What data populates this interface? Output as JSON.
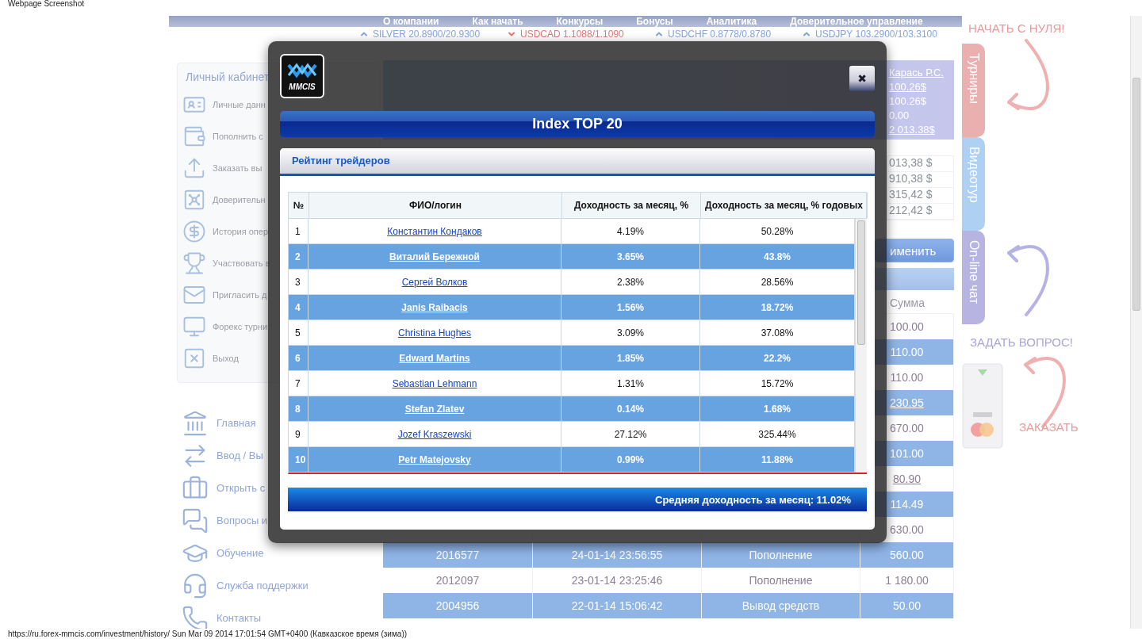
{
  "page_title": "Webpage Screenshot",
  "nav": [
    "О компании",
    "Как начать",
    "Конкурсы",
    "Бонусы",
    "Аналитика",
    "Доверительное управление"
  ],
  "ticker": [
    {
      "text": "SILVER 20.8900/20.9300",
      "up": true
    },
    {
      "text": "USDCAD 1.1088/1.1090",
      "up": false
    },
    {
      "text": "USDCHF 0.8778/0.8780",
      "up": true
    },
    {
      "text": "USDJPY 103.2900/103.3100",
      "up": true
    }
  ],
  "cabinet": {
    "title": "Личный кабинет",
    "items": [
      "Личные данн",
      "Пополнить с",
      "Заказать вы",
      "Доверительн",
      "История опер",
      "Участвовать в",
      "Пригласить д",
      "Форекс турни",
      "Выход"
    ]
  },
  "menu": [
    "Главная",
    "Ввод / Вы",
    "Открыть с",
    "Вопросы и",
    "Обучение",
    "Служба поддержки",
    "Контакты"
  ],
  "account": {
    "values": [
      {
        "value": "Карась Р.С.",
        "link": true
      },
      {
        "value": "100.26$",
        "link": true
      },
      {
        "value": "100.26$",
        "link": false
      },
      {
        "value": "0.00",
        "link": false
      },
      {
        "value": "2 013.38$",
        "link": true
      }
    ]
  },
  "stats": [
    "013,38 $",
    "910,38 $",
    "315,42 $",
    "212,42 $"
  ],
  "apply_button": "именить",
  "history": {
    "amount_header": "Сумма",
    "rows": [
      {
        "amount": "100.00",
        "link": false
      },
      {
        "amount": "110.00",
        "link": false
      },
      {
        "amount": "110.00",
        "link": false
      },
      {
        "amount": "230.95",
        "link": true
      },
      {
        "amount": "670.00",
        "link": false
      },
      {
        "amount": "101.00",
        "link": false
      },
      {
        "amount": "80.90",
        "link": true
      },
      {
        "amount": "114.49",
        "link": false
      },
      {
        "amount": "630.00",
        "link": false
      },
      {
        "id": "2016577",
        "date": "24-01-14 23:56:55",
        "type": "Пополнение",
        "amount": "560.00",
        "link": false
      },
      {
        "id": "2012097",
        "date": "23-01-14 23:25:46",
        "type": "Пополнение",
        "amount": "1 180.00",
        "link": false
      },
      {
        "id": "2004956",
        "date": "22-01-14 15:06:42",
        "type": "Вывод средств",
        "amount": "50.00",
        "link": false
      }
    ]
  },
  "rail": {
    "start": "НАЧАТЬ С НУЛЯ!",
    "tabs": [
      {
        "label": "Турниры",
        "color": "#eab0b0"
      },
      {
        "label": "Видеотур",
        "color": "#aed0f2"
      },
      {
        "label": "On-line чат",
        "color": "#b8b4e2"
      }
    ],
    "ask": "ЗАДАТЬ ВОПРОС!",
    "order": "ЗАКАЗАТЬ"
  },
  "modal": {
    "logo_text": "MMCIS",
    "close": "✖",
    "title": "Index TOP 20",
    "panel_title": "Рейтинг трейдеров",
    "columns": [
      "№",
      "ФИО/логин",
      "Доходность за месяц, %",
      "Доходность за месяц, % годовых"
    ],
    "rows": [
      {
        "rank": "1",
        "name": "Константин Кондаков",
        "month": "4.19%",
        "year": "50.28%"
      },
      {
        "rank": "2",
        "name": "Виталий Бережной",
        "month": "3.65%",
        "year": "43.8%"
      },
      {
        "rank": "3",
        "name": "Сергей Волков",
        "month": "2.38%",
        "year": "28.56%"
      },
      {
        "rank": "4",
        "name": "Janis Raibacis",
        "month": "1.56%",
        "year": "18.72%"
      },
      {
        "rank": "5",
        "name": "Christina Hughes",
        "month": "3.09%",
        "year": "37.08%"
      },
      {
        "rank": "6",
        "name": "Edward Martins",
        "month": "1.85%",
        "year": "22.2%"
      },
      {
        "rank": "7",
        "name": "Sebastian Lehmann",
        "month": "1.31%",
        "year": "15.72%"
      },
      {
        "rank": "8",
        "name": "Stefan Zlatev",
        "month": "0.14%",
        "year": "1.68%"
      },
      {
        "rank": "9",
        "name": "Jozef Kraszewski",
        "month": "27.12%",
        "year": "325.44%"
      },
      {
        "rank": "10",
        "name": "Petr Matejovsky",
        "month": "0.99%",
        "year": "11.88%"
      }
    ],
    "average": "Средняя доходность за месяц: 11.02%"
  },
  "status_bar": "https://ru.forex-mmcis.com/investment/history/ Sun Mar 09 2014 17:01:54 GMT+0400 (Кавказское время (зима))"
}
